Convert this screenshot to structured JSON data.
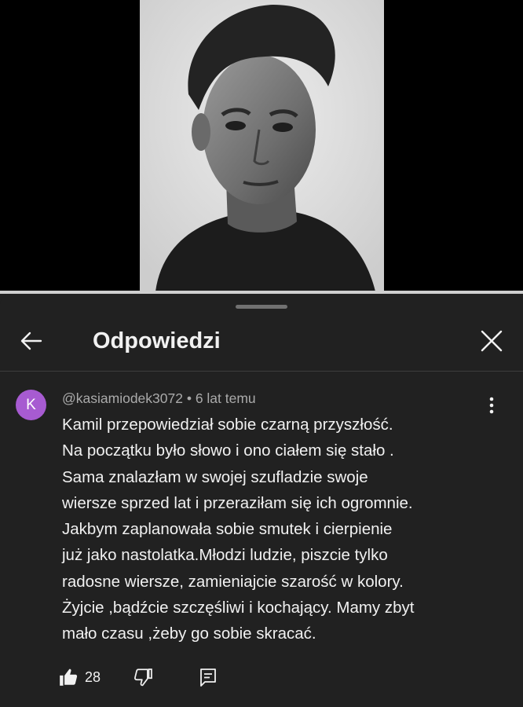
{
  "video": {
    "progress": 1.0
  },
  "panel": {
    "title": "Odpowiedzi",
    "back_icon": "arrow-left-icon",
    "close_icon": "close-icon"
  },
  "comment": {
    "avatar_letter": "K",
    "avatar_color": "#a75bd1",
    "meta": "@kasiamiodek3072 • 6 lat temu",
    "lines": [
      "Kamil przepowiedział sobie czarną przyszłość.",
      "Na początku było słowo i ono ciałem się stało .",
      "Sama znalazłam w swojej szufladzie swoje",
      "wiersze sprzed lat i przeraziłam się ich ogromnie.",
      "Jakbym zaplanowała sobie smutek i cierpienie",
      "już jako nastolatka.Młodzi ludzie, piszcie tylko",
      "radosne wiersze, zamieniajcie szarość w kolory.",
      "Żyjcie ,bądźcie szczęśliwi i kochający. Mamy zbyt",
      "mało czasu ,żeby go sobie skracać."
    ],
    "like_count": "28",
    "icons": {
      "like": "thumbs-up-icon",
      "dislike": "thumbs-down-icon",
      "reply": "reply-icon",
      "more": "more-vert-icon"
    }
  }
}
